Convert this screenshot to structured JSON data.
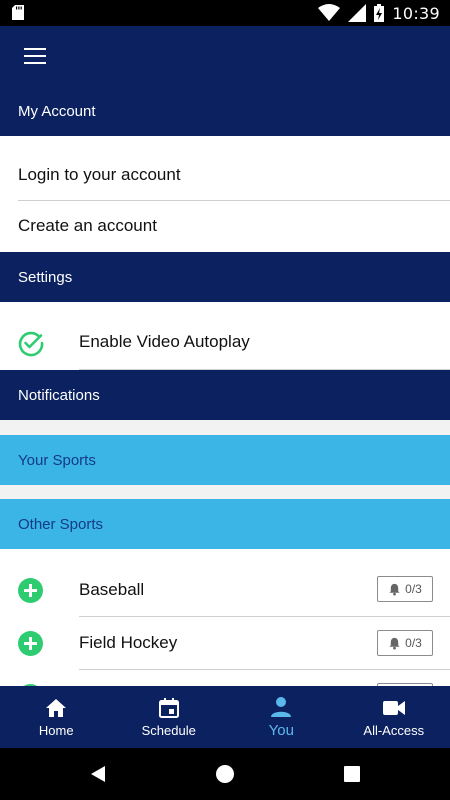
{
  "status_bar": {
    "time": "10:39",
    "icons": [
      "sd-card-icon",
      "wifi-icon",
      "signal-icon",
      "battery-charging-icon"
    ]
  },
  "app_bar": {
    "menu_icon": "hamburger-icon"
  },
  "sections": {
    "my_account": "My Account",
    "settings": "Settings",
    "notifications": "Notifications",
    "your_sports": "Your Sports",
    "other_sports": "Other Sports"
  },
  "account": {
    "login": "Login to your account",
    "create": "Create an account"
  },
  "settings": {
    "autoplay": "Enable Video Autoplay",
    "autoplay_enabled": true
  },
  "other_sports": [
    {
      "name": "Baseball",
      "count": "0/3"
    },
    {
      "name": "Field Hockey",
      "count": "0/3"
    }
  ],
  "tabs": [
    {
      "label": "Home",
      "icon": "home-icon",
      "active": false
    },
    {
      "label": "Schedule",
      "icon": "calendar-icon",
      "active": false
    },
    {
      "label": "You",
      "icon": "person-icon",
      "active": true
    },
    {
      "label": "All-Access",
      "icon": "video-camera-icon",
      "active": false
    }
  ],
  "colors": {
    "navy": "#0c2160",
    "light_blue": "#3bb4e6",
    "green": "#2ecc71",
    "active_tab": "#5bb8ea"
  }
}
